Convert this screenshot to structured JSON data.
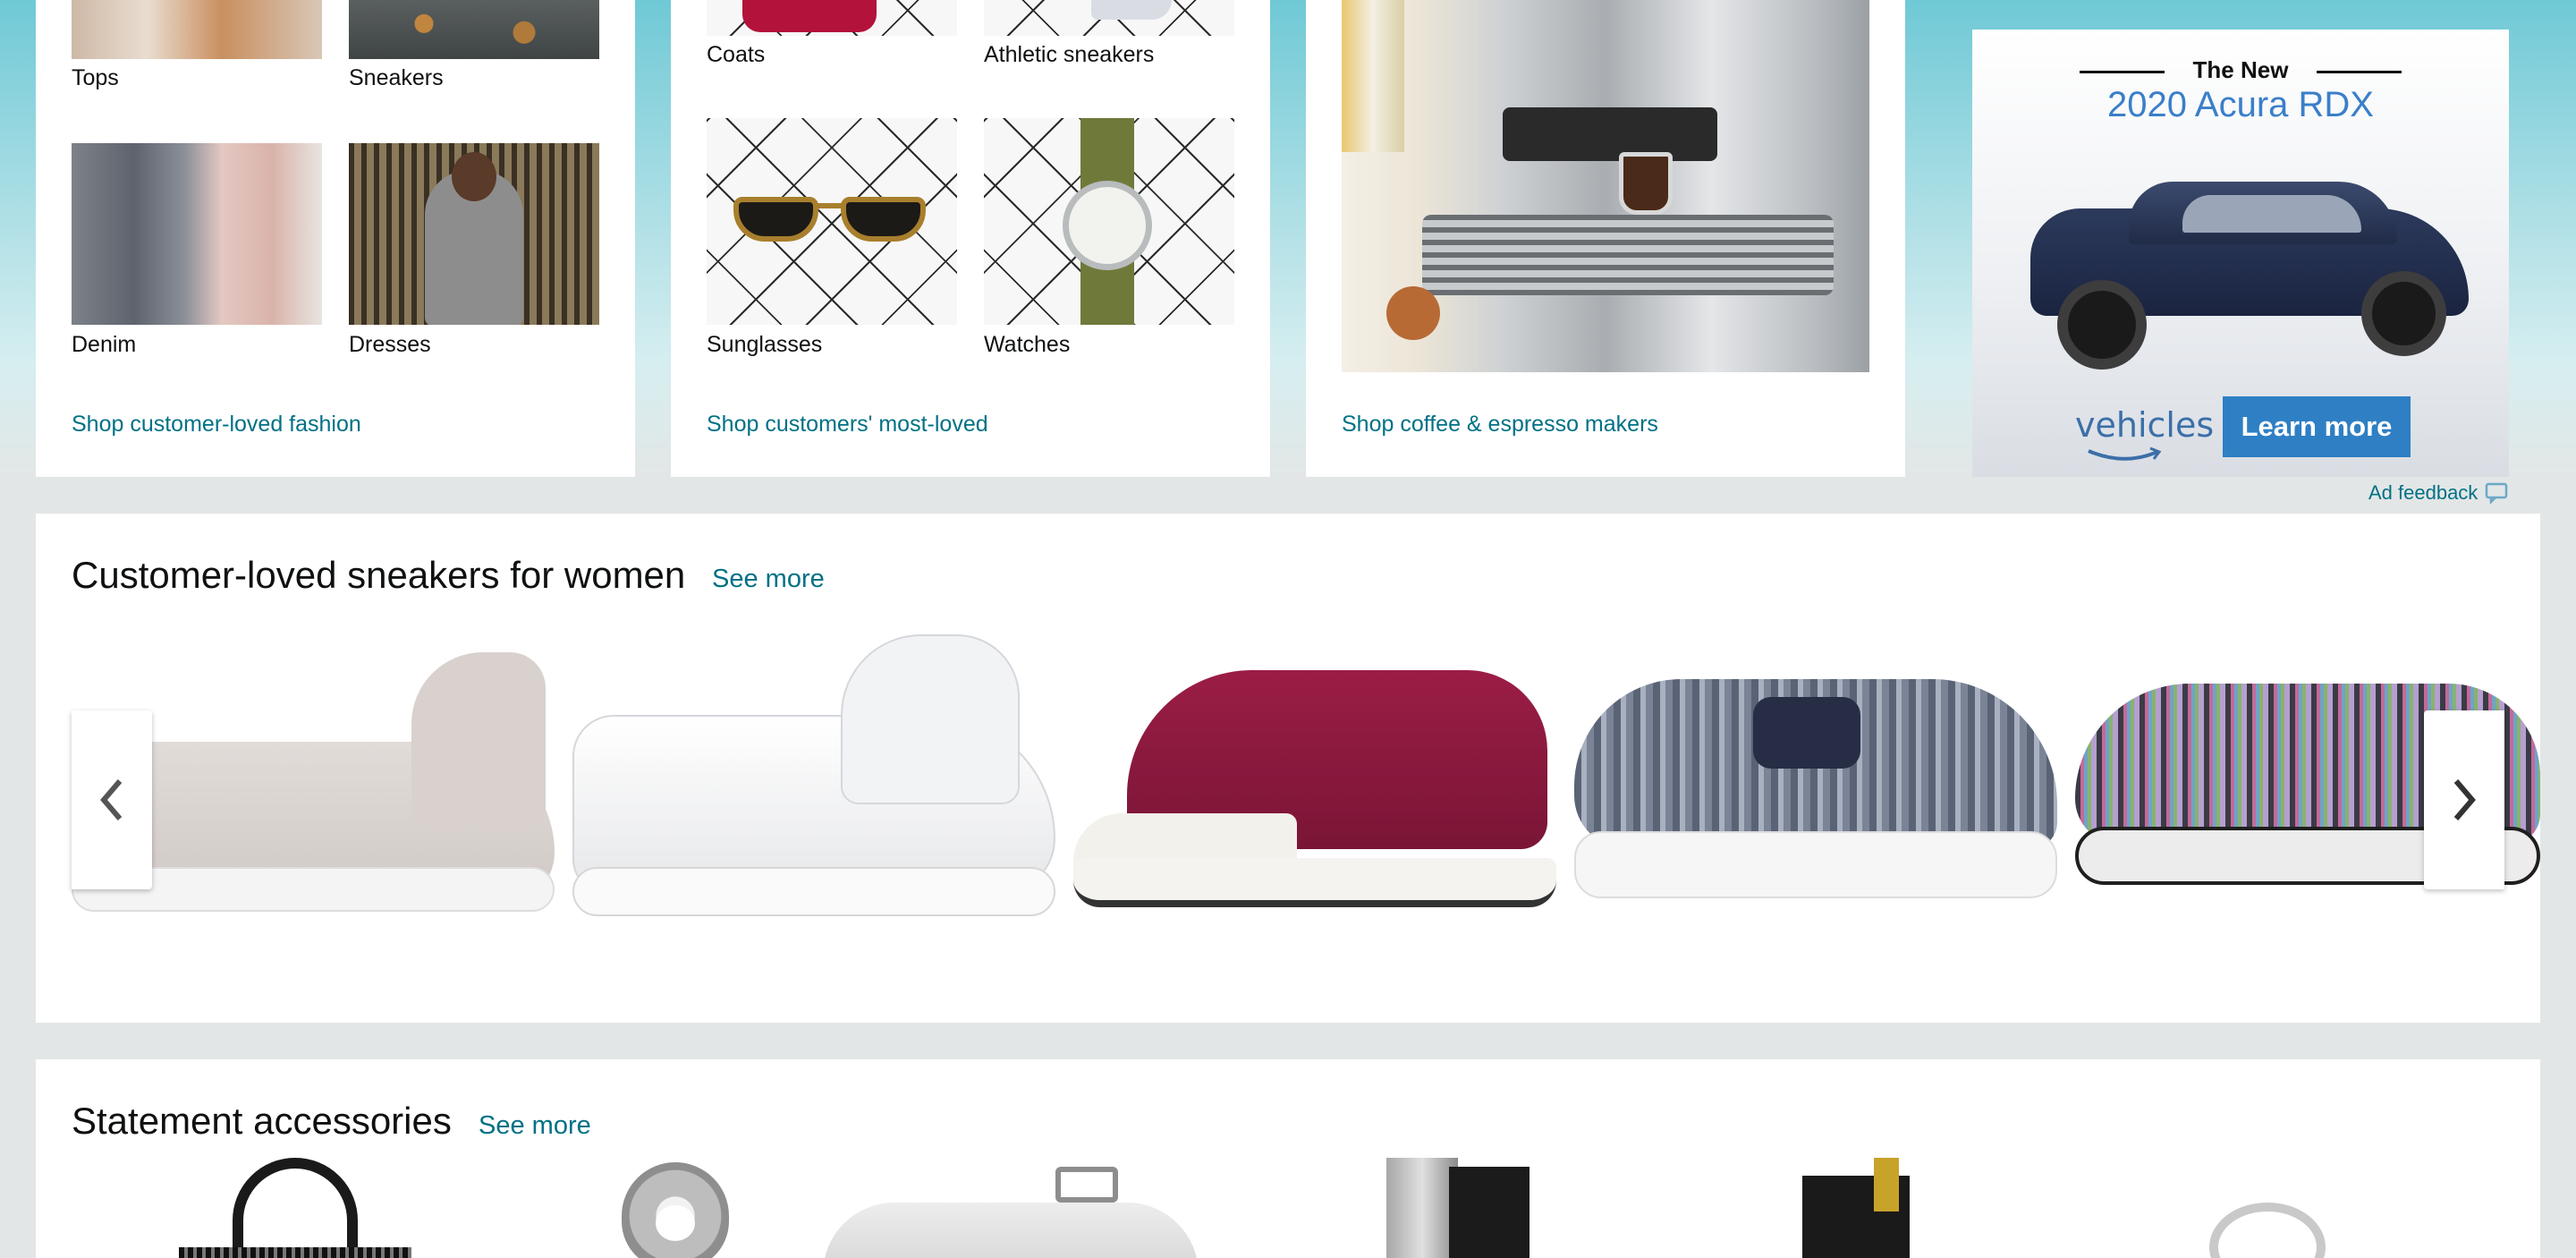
{
  "fashion_card": {
    "tiles": [
      {
        "label": "Tops"
      },
      {
        "label": "Sneakers"
      },
      {
        "label": "Denim"
      },
      {
        "label": "Dresses"
      }
    ],
    "link": "Shop customer-loved fashion"
  },
  "loved_card": {
    "tiles": [
      {
        "label": "Coats"
      },
      {
        "label": "Athletic sneakers"
      },
      {
        "label": "Sunglasses"
      },
      {
        "label": "Watches"
      }
    ],
    "link": "Shop customers' most-loved"
  },
  "coffee_card": {
    "link": "Shop coffee & espresso makers"
  },
  "ad": {
    "the_new": "The New",
    "model": "2020 Acura RDX",
    "brand": "vehicles",
    "cta": "Learn more",
    "feedback": "Ad feedback"
  },
  "sneakers_section": {
    "title": "Customer-loved sneakers for women",
    "see_more": "See more",
    "products": [
      "gray-knit-sneaker",
      "white-leather-sneaker",
      "burgundy-canvas-sneaker",
      "striped-slip-on-sneaker",
      "multicolor-knit-sneaker"
    ]
  },
  "accessories_section": {
    "title": "Statement accessories",
    "see_more": "See more"
  },
  "colors": {
    "link": "#007185",
    "background": "#e3e6e6",
    "ad_button": "#2e7fc4"
  }
}
